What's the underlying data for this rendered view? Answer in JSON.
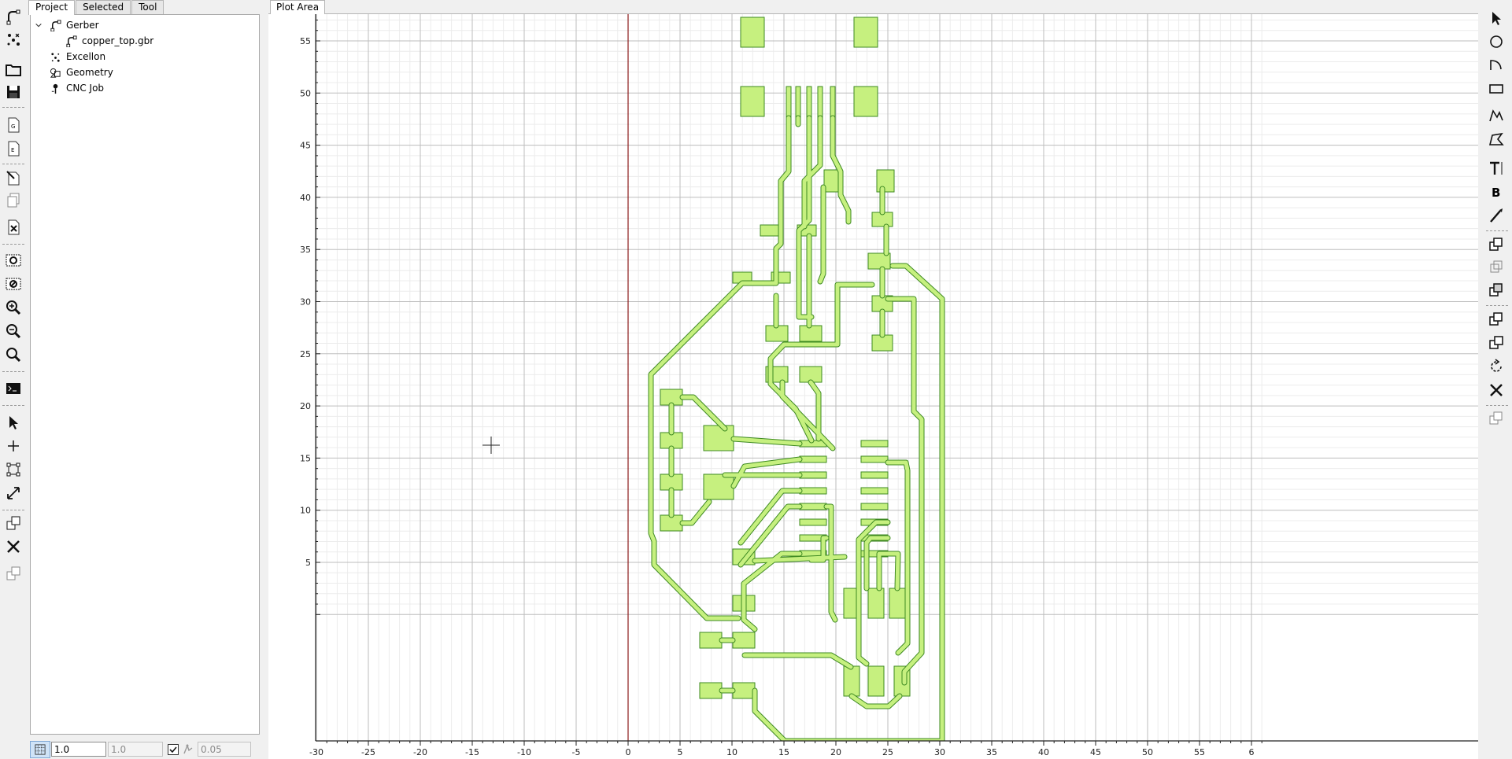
{
  "notebook": {
    "tabs": [
      {
        "label": "Project",
        "active": true
      },
      {
        "label": "Selected",
        "active": false
      },
      {
        "label": "Tool",
        "active": false
      }
    ]
  },
  "tree": {
    "groups": [
      {
        "label": "Gerber",
        "expanded": true,
        "icon": "gerber-icon",
        "children": [
          {
            "label": "copper_top.gbr",
            "icon": "gerber-file-icon"
          }
        ]
      },
      {
        "label": "Excellon",
        "icon": "excellon-icon"
      },
      {
        "label": "Geometry",
        "icon": "geometry-icon"
      },
      {
        "label": "CNC Job",
        "icon": "cnc-job-icon"
      }
    ]
  },
  "plot": {
    "tab_label": "Plot Area",
    "x_ticks": [
      "-30",
      "-25",
      "-20",
      "-15",
      "-10",
      "-5",
      "0",
      "5",
      "10",
      "15",
      "20",
      "25",
      "30",
      "35",
      "40",
      "45",
      "50",
      "55",
      "6"
    ],
    "y_ticks": [
      "55",
      "50",
      "45",
      "40",
      "35",
      "30",
      "25",
      "20",
      "15",
      "10",
      "5"
    ],
    "trace_color": "#c6f07f",
    "outline_color": "#3e8a22",
    "origin_line_color": "#8b1a1a"
  },
  "bottom": {
    "grid_x": "1.0",
    "grid_y": "1.0",
    "snap_max": "0.05"
  }
}
